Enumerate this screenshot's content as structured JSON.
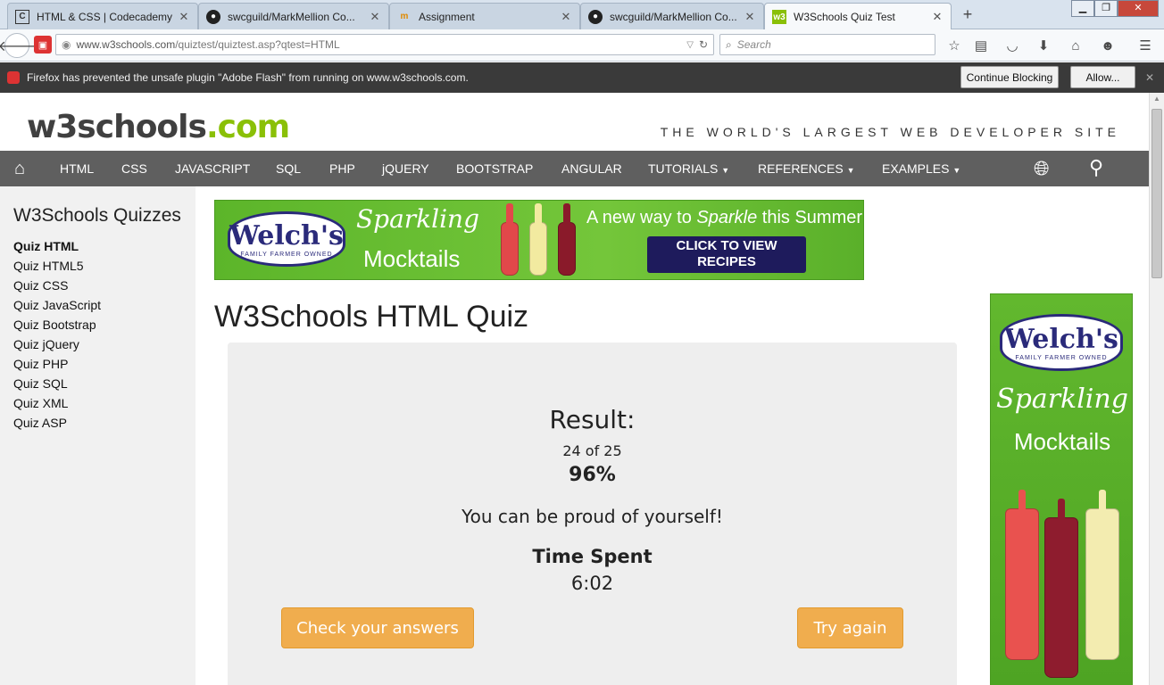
{
  "browser": {
    "tabs": [
      {
        "title": "HTML & CSS | Codecademy",
        "favicon": "codecademy-icon"
      },
      {
        "title": "swcguild/MarkMellion Co...",
        "favicon": "github-icon"
      },
      {
        "title": "Assignment",
        "favicon": "moodle-icon"
      },
      {
        "title": "swcguild/MarkMellion Co...",
        "favicon": "github-icon"
      },
      {
        "title": "W3Schools Quiz Test",
        "favicon": "w3schools-icon",
        "active": true
      }
    ],
    "url": "www.w3schools.com/quiztest/quiztest.asp?qtest=HTML",
    "url_host": "www.w3schools.com",
    "url_path": "/quiztest/quiztest.asp?qtest=HTML",
    "search_placeholder": "Search",
    "plugin_message": "Firefox has prevented the unsafe plugin \"Adobe Flash\" from running on www.w3schools.com.",
    "continue_blocking_label": "Continue Blocking",
    "allow_label": "Allow..."
  },
  "site": {
    "logo_main": "w3schools",
    "logo_suffix": ".com",
    "tagline": "THE WORLD'S LARGEST WEB DEVELOPER SITE",
    "nav": [
      "HTML",
      "CSS",
      "JAVASCRIPT",
      "SQL",
      "PHP",
      "jQUERY",
      "BOOTSTRAP",
      "ANGULAR",
      "TUTORIALS",
      "REFERENCES",
      "EXAMPLES"
    ],
    "accent_color": "#8ac007",
    "nav_bg": "#5f5f5f"
  },
  "sidebar": {
    "title": "W3Schools Quizzes",
    "items": [
      "Quiz HTML",
      "Quiz HTML5",
      "Quiz CSS",
      "Quiz JavaScript",
      "Quiz Bootstrap",
      "Quiz jQuery",
      "Quiz PHP",
      "Quiz SQL",
      "Quiz XML",
      "Quiz ASP"
    ],
    "active_index": 0
  },
  "banner_ad": {
    "brand": "Welch's",
    "brand_sub": "FAMILY FARMER OWNED",
    "line1": "Sparkling",
    "line2": "Mocktails",
    "headline_pre": "A new way to ",
    "headline_em": "Sparkle",
    "headline_post": " this Summer",
    "cta_line1": "CLICK TO VIEW",
    "cta_line2": "RECIPES"
  },
  "side_ad": {
    "brand": "Welch's",
    "brand_sub": "FAMILY FARMER OWNED",
    "line1": "Sparkling",
    "line2": "Mocktails"
  },
  "quiz": {
    "title": "W3Schools HTML Quiz",
    "result_heading": "Result:",
    "score_text": "24 of 25",
    "percent_text": "96%",
    "message": "You can be proud of yourself!",
    "time_label": "Time Spent",
    "time_value": "6:02",
    "check_button": "Check your answers",
    "retry_button": "Try again",
    "button_color": "#f0ad4e"
  }
}
